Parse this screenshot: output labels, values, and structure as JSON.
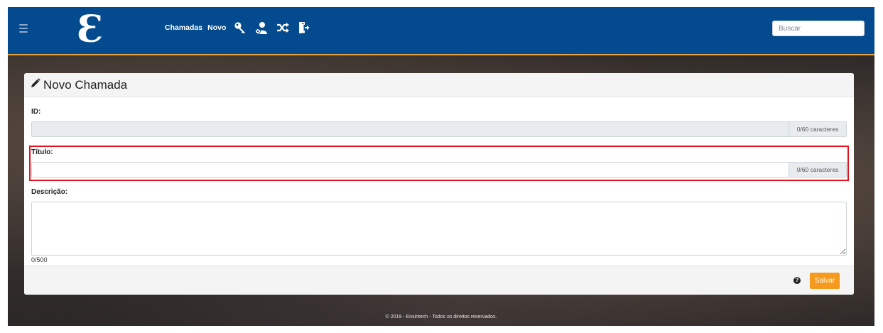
{
  "search": {
    "placeholder": "Buscar"
  },
  "brand": {
    "logo_text": "Ɛ"
  },
  "nav": {
    "links": [
      {
        "label": "Chamadas"
      },
      {
        "label": "Novo"
      }
    ],
    "icons": [
      "key-icon",
      "user-settings-icon",
      "shuffle-icon",
      "logout-icon"
    ]
  },
  "form": {
    "title": "Novo Chamada",
    "fields": {
      "id": {
        "label": "ID:",
        "value": "",
        "counter": "0/60 caracteres"
      },
      "titulo": {
        "label": "Título:",
        "value": "",
        "counter": "0/60 caracteres"
      },
      "descricao": {
        "label": "Descrição:",
        "value": "",
        "counter": "0/500"
      }
    },
    "save_label": "Salvar",
    "help_symbol": "?"
  },
  "footer": {
    "text": "© 2019 - Ensintech - Todos os direitos reservados."
  },
  "colors": {
    "navbar": "#034b8e",
    "navbar_border": "#e8a13a",
    "save_button": "#f59a1c",
    "highlight": "#e0131f"
  }
}
